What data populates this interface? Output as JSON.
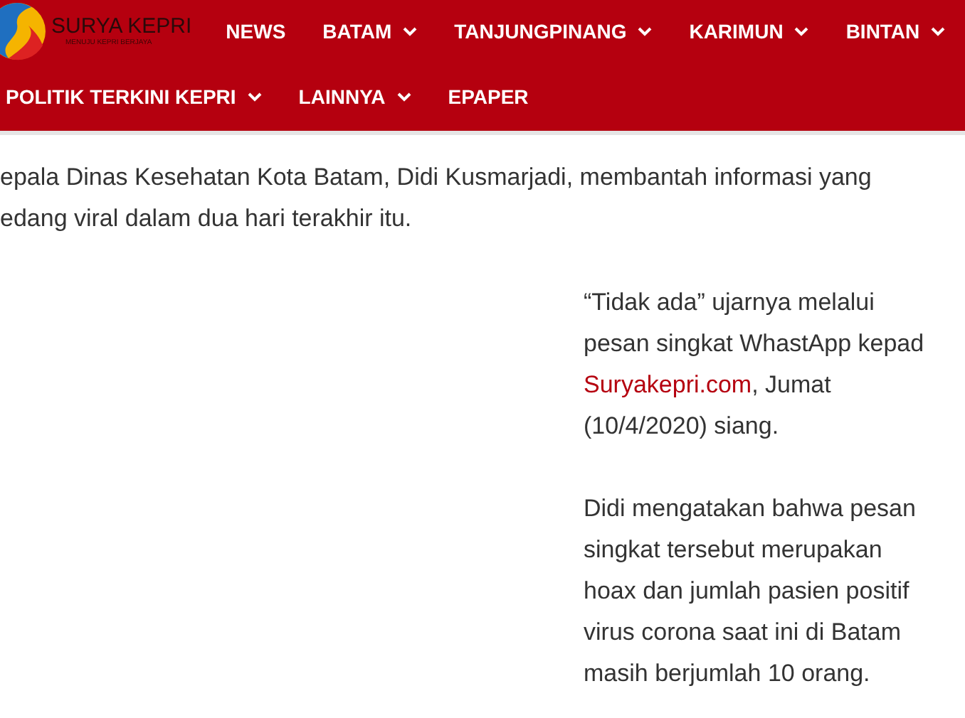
{
  "logo": {
    "name": "SURYA KEPRI",
    "tagline": "MENUJU KEPRI BERJAYA"
  },
  "nav": {
    "rows": [
      [
        {
          "label": "NEWS",
          "dropdown": false
        },
        {
          "label": "BATAM",
          "dropdown": true
        },
        {
          "label": "TANJUNGPINANG",
          "dropdown": true
        },
        {
          "label": "KARIMUN",
          "dropdown": true
        },
        {
          "label": "BINTAN",
          "dropdown": true
        }
      ],
      [
        {
          "label": "POLITIK TERKINI KEPRI",
          "dropdown": true
        },
        {
          "label": "LAINNYA",
          "dropdown": true
        },
        {
          "label": "EPAPER",
          "dropdown": false
        }
      ]
    ]
  },
  "lead_paragraph": [
    "epala Dinas Kesehatan Kota Batam, Didi Kusmarjadi, membantah informasi yang",
    "edang viral dalam dua hari terakhir itu."
  ],
  "paragraphs": [
    {
      "lines": [
        {
          "text": "“Tidak ada” ujarnya melalui"
        },
        {
          "text": "pesan singkat WhastApp kepad"
        },
        {
          "link": "Suryakepri.com",
          "text": ", Jumat"
        },
        {
          "text": "(10/4/2020) siang."
        }
      ]
    },
    {
      "lines": [
        {
          "text": "Didi mengatakan bahwa pesan"
        },
        {
          "text": "singkat tersebut merupakan"
        },
        {
          "text": "hoax dan jumlah pasien positif"
        },
        {
          "text": "virus corona saat ini di Batam"
        },
        {
          "text": "masih berjumlah 10 orang."
        }
      ]
    }
  ]
}
